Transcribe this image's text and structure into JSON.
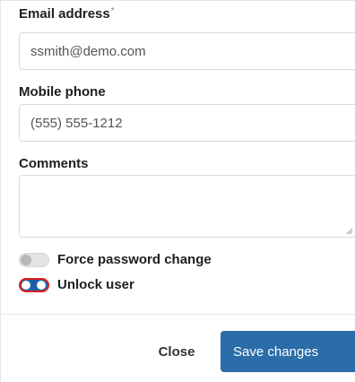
{
  "form": {
    "email": {
      "label": "Email address",
      "required_mark": "*",
      "value": "ssmith@demo.com"
    },
    "mobile": {
      "label": "Mobile phone",
      "value": "(555) 555-1212"
    },
    "comments": {
      "label": "Comments",
      "value": ""
    },
    "force_password_change": {
      "label": "Force password change",
      "checked": false
    },
    "unlock_user": {
      "label": "Unlock user",
      "checked": true
    }
  },
  "footer": {
    "close_label": "Close",
    "save_label": "Save changes"
  },
  "colors": {
    "primary": "#2a6da8",
    "toggle_focus_ring": "#e0201a"
  }
}
